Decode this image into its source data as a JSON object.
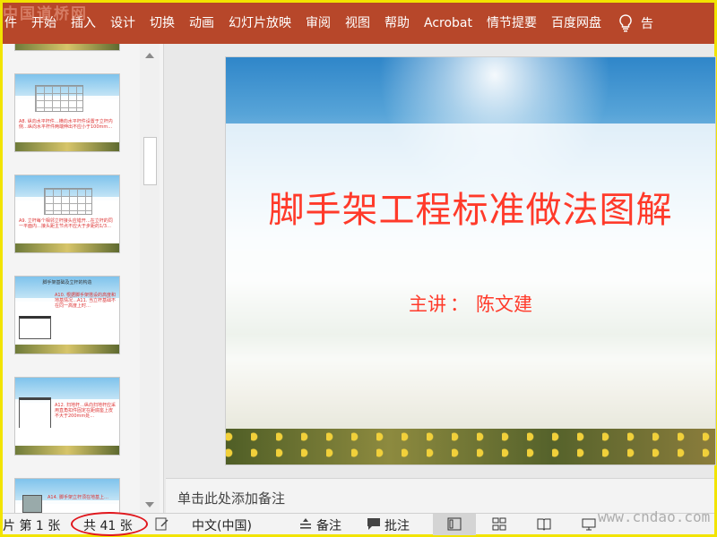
{
  "watermark_top": "中国道桥网",
  "watermark_bottom": "www.cndao.com",
  "ribbon": {
    "tabs": [
      "件",
      "开始",
      "插入",
      "设计",
      "切换",
      "动画",
      "幻灯片放映",
      "审阅",
      "视图",
      "帮助",
      "Acrobat",
      "情节提要",
      "百度网盘"
    ],
    "tell_me_cut": "告"
  },
  "thumbnails": [
    {
      "title": "",
      "text": "A8. 纵向水平杆件…横向水平杆件设置于立杆内侧…纵向水平杆件两端伸出不应小于100mm…"
    },
    {
      "title": "",
      "text": "A9. 立杆每个相邻立杆接头应错开…在立杆的同一平面内…接头距主节点不应大于步距的1/3…"
    },
    {
      "title": "脚手架基础及立杆的构造",
      "text": "A10. 根据脚手架搭设的高度和地基情况…A11. 当立杆基础不在同一高度上时…"
    },
    {
      "title": "",
      "text": "A12. 扫地杆…纵向扫地杆应采用直角扣件固定在距底座上皮不大于200mm处…"
    },
    {
      "title": "",
      "text": "A14. 脚手架立杆须在地基上…"
    }
  ],
  "slide": {
    "title": "脚手架工程标准做法图解",
    "subtitle_label": "主讲",
    "subtitle_colon": "：",
    "subtitle_name": "陈文建"
  },
  "notes": {
    "placeholder": "单击此处添加备注"
  },
  "status": {
    "slide_pos": "片 第 1 张",
    "total": "共 41 张",
    "language": "中文(中国)",
    "notes_btn": "备注",
    "comments_btn": "批注"
  },
  "colors": {
    "ribbon_bg": "#b7472a",
    "title_red": "#ff3a2a",
    "highlight_oval": "#e0161c",
    "border_yellow": "#f2e400"
  }
}
